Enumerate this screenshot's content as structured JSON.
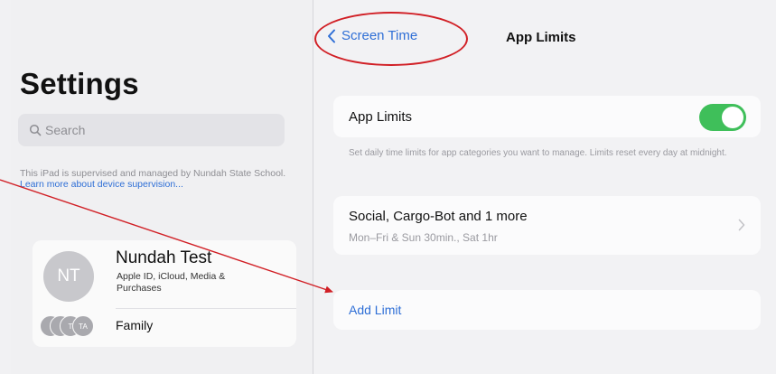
{
  "sidebar": {
    "title": "Settings",
    "search_placeholder": "Search",
    "supervision_text": "This iPad is supervised and managed by Nundah State School.",
    "supervision_link": "Learn more about device supervision...",
    "profile": {
      "initials": "NT",
      "name": "Nundah Test",
      "subtitle": "Apple ID, iCloud, Media & Purchases"
    },
    "family": {
      "label": "Family",
      "avatar_initials": [
        "",
        "",
        "T",
        "TA"
      ]
    }
  },
  "nav": {
    "back_label": "Screen Time",
    "title": "App Limits"
  },
  "app_limits": {
    "toggle_label": "App Limits",
    "toggle_on": true,
    "footnote": "Set daily time limits for app categories you want to manage. Limits reset every day at midnight."
  },
  "limit_item": {
    "title": "Social, Cargo-Bot and 1 more",
    "schedule": "Mon–Fri & Sun 30min., Sat 1hr"
  },
  "add_limit_label": "Add Limit",
  "colors": {
    "accent": "#2f6fd6",
    "toggle": "#3fbf5a",
    "annotation": "#d11f25"
  }
}
